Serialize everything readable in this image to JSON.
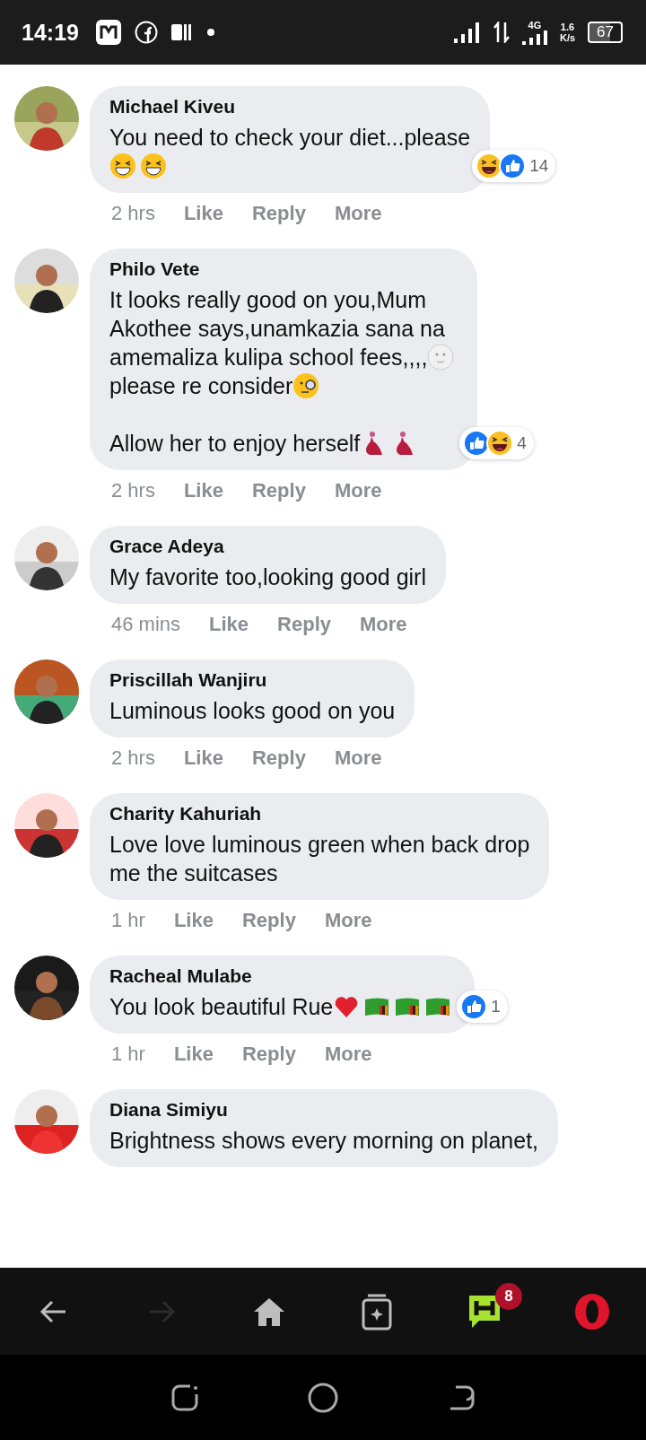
{
  "status_bar": {
    "time": "14:19",
    "network": "4G",
    "speed_value": "1.6",
    "speed_unit": "K/s",
    "battery": "67"
  },
  "comments": [
    {
      "name": "Michael Kiveu",
      "paragraphs": [
        [
          [
            {
              "kind": "text",
              "text": "You need to check your diet...please"
            }
          ],
          [
            {
              "kind": "laugh"
            },
            {
              "kind": "laugh"
            }
          ]
        ]
      ],
      "reactions": {
        "icons": [
          {
            "kind": "haha"
          },
          {
            "kind": "like"
          }
        ],
        "count": "14"
      },
      "time": "2 hrs",
      "actions": [
        "Like",
        "Reply",
        "More"
      ]
    },
    {
      "name": "Philo Vete",
      "paragraphs": [
        [
          [
            {
              "kind": "text",
              "text": "It looks really good on you,Mum"
            }
          ],
          [
            {
              "kind": "text",
              "text": "Akothee says,unamkazia sana na"
            }
          ],
          [
            {
              "kind": "text",
              "text": "amemaliza kulipa school fees,,,,"
            },
            {
              "kind": "moon"
            }
          ],
          [
            {
              "kind": "text",
              "text": "please re consider"
            },
            {
              "kind": "monocle"
            }
          ]
        ],
        [
          [
            {
              "kind": "text",
              "text": "Allow her to enjoy herself"
            },
            {
              "kind": "dancer"
            },
            {
              "kind": "dancer"
            }
          ]
        ]
      ],
      "reactions": {
        "icons": [
          {
            "kind": "like"
          },
          {
            "kind": "haha"
          }
        ],
        "count": "4"
      },
      "time": "2 hrs",
      "actions": [
        "Like",
        "Reply",
        "More"
      ]
    },
    {
      "name": "Grace Adeya",
      "paragraphs": [
        [
          [
            {
              "kind": "text",
              "text": "My favorite too,looking good girl"
            }
          ]
        ]
      ],
      "time": "46 mins",
      "actions": [
        "Like",
        "Reply",
        "More"
      ]
    },
    {
      "name": "Priscillah Wanjiru",
      "paragraphs": [
        [
          [
            {
              "kind": "text",
              "text": "Luminous looks good on you"
            }
          ]
        ]
      ],
      "time": "2 hrs",
      "actions": [
        "Like",
        "Reply",
        "More"
      ]
    },
    {
      "name": "Charity Kahuriah",
      "paragraphs": [
        [
          [
            {
              "kind": "text",
              "text": "Love love luminous green when back drop"
            }
          ],
          [
            {
              "kind": "text",
              "text": "me the suitcases"
            }
          ]
        ]
      ],
      "time": "1 hr",
      "actions": [
        "Like",
        "Reply",
        "More"
      ]
    },
    {
      "name": "Racheal Mulabe",
      "paragraphs": [
        [
          [
            {
              "kind": "text",
              "text": "You look beautiful Rue"
            },
            {
              "kind": "heart"
            },
            {
              "kind": "flag"
            },
            {
              "kind": "flag"
            },
            {
              "kind": "flag"
            }
          ]
        ]
      ],
      "reactions": {
        "icons": [
          {
            "kind": "like"
          }
        ],
        "count": "1"
      },
      "time": "1 hr",
      "actions": [
        "Like",
        "Reply",
        "More"
      ]
    },
    {
      "name": "Diana Simiyu",
      "paragraphs": [
        [
          [
            {
              "kind": "text",
              "text": "Brightness shows every morning on planet,"
            }
          ]
        ]
      ]
    }
  ],
  "browser_nav": [
    {
      "kind": "back",
      "disabled": false
    },
    {
      "kind": "forward",
      "disabled": true
    },
    {
      "kind": "home",
      "disabled": false
    },
    {
      "kind": "tabs",
      "disabled": false
    },
    {
      "kind": "chat",
      "disabled": false,
      "badge": "8"
    },
    {
      "kind": "opera",
      "disabled": false
    }
  ]
}
